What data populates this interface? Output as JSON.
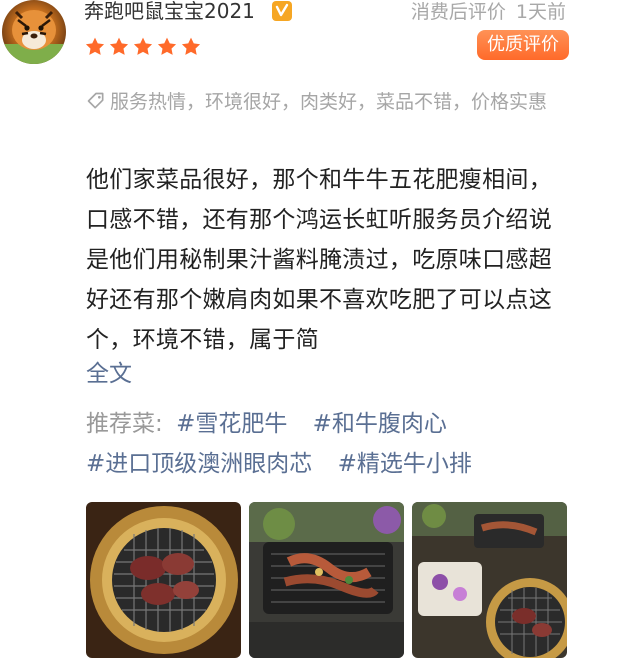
{
  "user": {
    "name": "奔跑吧鼠宝宝2021",
    "badge_icon": "vip-level-icon"
  },
  "meta": {
    "status": "消费后评价",
    "time": "1天前"
  },
  "rating": {
    "stars": 5,
    "max": 5,
    "color": "#ff6a2a"
  },
  "quality_badge": "优质评价",
  "tags": {
    "icon": "tag-icon",
    "text": "服务热情，环境很好，肉类好，菜品不错，价格实惠"
  },
  "review": {
    "text": "他们家菜品很好，那个和牛牛五花肥瘦相间，口感不错，还有那个鸿运长虹听服务员介绍说是他们用秘制果汁酱料腌渍过，吃原味口感超好还有那个嫩肩肉如果不喜欢吃肥了可以点这个，环境不错，属于简",
    "more_label": "全文"
  },
  "recommended": {
    "label": "推荐菜:",
    "dishes": [
      "#雪花肥牛",
      "#和牛腹肉心",
      "#进口顶级澳洲眼肉芯",
      "#精选牛小排"
    ]
  },
  "photos": [
    {
      "description_icon": "grill-meat-photo"
    },
    {
      "description_icon": "plated-beef-photo"
    },
    {
      "description_icon": "table-spread-photo"
    }
  ],
  "colors": {
    "accent": "#ff6a2a",
    "link": "#5a6f93",
    "muted": "#a6a6a6"
  }
}
